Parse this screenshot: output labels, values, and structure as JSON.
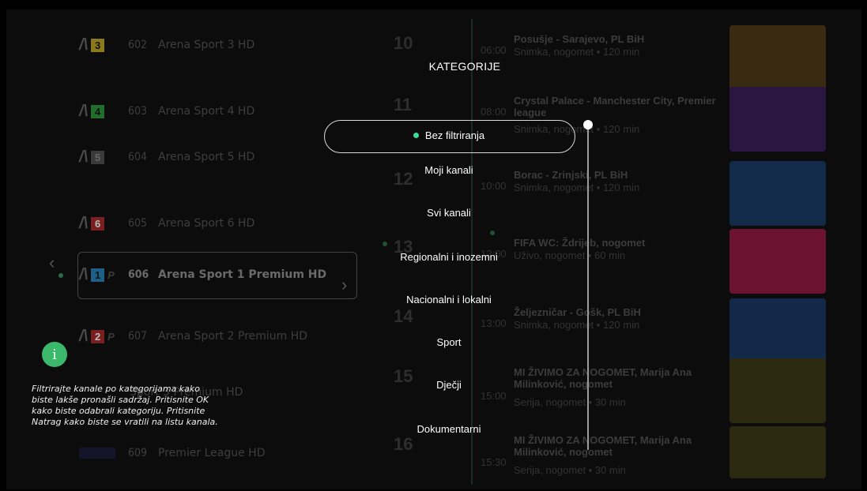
{
  "channels": [
    {
      "logo_num": "3",
      "logo_color": "#8a7a1a",
      "premium": "",
      "number": "602",
      "name": "Arena Sport 3 HD"
    },
    {
      "logo_num": "4",
      "logo_color": "#1f6e2c",
      "premium": "",
      "number": "603",
      "name": "Arena Sport 4 HD"
    },
    {
      "logo_num": "5",
      "logo_color": "#3a3a3a",
      "premium": "",
      "number": "604",
      "name": "Arena Sport 5 HD"
    },
    {
      "logo_num": "6",
      "logo_color": "#7a2020",
      "premium": "",
      "number": "605",
      "name": "Arena Sport 6 HD"
    },
    {
      "logo_num": "1",
      "logo_color": "#1d5f86",
      "premium": "P",
      "number": "606",
      "name": "Arena Sport 1 Premium HD"
    },
    {
      "logo_num": "2",
      "logo_color": "#7a1f1f",
      "premium": "P",
      "number": "607",
      "name": "Arena Sport 2 Premium HD"
    },
    {
      "logo_num": "",
      "logo_color": "#0c0c0c",
      "premium": "",
      "number": "",
      "name": "Sport 3 Premium HD"
    },
    {
      "logo_num": "",
      "logo_color": "#0c0c0c",
      "premium": "",
      "number": "609",
      "name": "Premier League HD"
    }
  ],
  "programs": [
    {
      "hour": "10",
      "time": "06:00",
      "title": "Posušje - Sarajevo, PL BiH",
      "subtitle": "Snimka, nogomet • 120 min",
      "thumb_color": "#3a2a12"
    },
    {
      "hour": "11",
      "time": "08:00",
      "title": "Crystal Palace - Manchester City, Premier league",
      "subtitle": "Snimka, nogomet • 120 min",
      "thumb_color": "#2a1640"
    },
    {
      "hour": "12",
      "time": "10:00",
      "title": "Borac - Zrinjski, PL BiH",
      "subtitle": "Snimka, nogomet • 120 min",
      "thumb_color": "#132a4a"
    },
    {
      "hour": "13",
      "time": "12:00",
      "title": "FIFA WC: Ždrijeb, nogomet",
      "subtitle": "Uživo, nogomet • 60 min",
      "thumb_color": "#6a1230"
    },
    {
      "hour": "14",
      "time": "13:00",
      "title": "Željezničar - Gošk, PL BiH",
      "subtitle": "Snimka, nogomet • 120 min",
      "thumb_color": "#14284a"
    },
    {
      "hour": "15",
      "time": "15:00",
      "title": "MI ŽIVIMO ZA NOGOMET, Marija Ana Milinković, nogomet",
      "subtitle": "Serija, nogomet • 30 min",
      "thumb_color": "#2b2a10"
    },
    {
      "hour": "16",
      "time": "15:30",
      "title": "MI ŽIVIMO ZA NOGOMET, Marija Ana Milinković, nogomet",
      "subtitle": "Serija, nogomet • 30 min",
      "thumb_color": "#2b2a10"
    }
  ],
  "categories": {
    "title": "KATEGORIJE",
    "items": [
      "Bez filtriranja",
      "Moji kanali",
      "Svi kanali",
      "Regionalni i inozemni",
      "Nacionalni i lokalni",
      "Sport",
      "Dječji",
      "Dokumentarni"
    ],
    "selected_index": 0
  },
  "info": {
    "icon": "info-icon",
    "text": "Filtrirajte kanale po kategorijama kako biste lakše pronašli sadržaj. Pritisnite OK kako biste odabrali kategoriju. Pritisnite Natrag kako biste se vratili na listu kanala."
  },
  "colors": {
    "accent": "#3ddc97",
    "info_icon": "#3bb86b"
  }
}
